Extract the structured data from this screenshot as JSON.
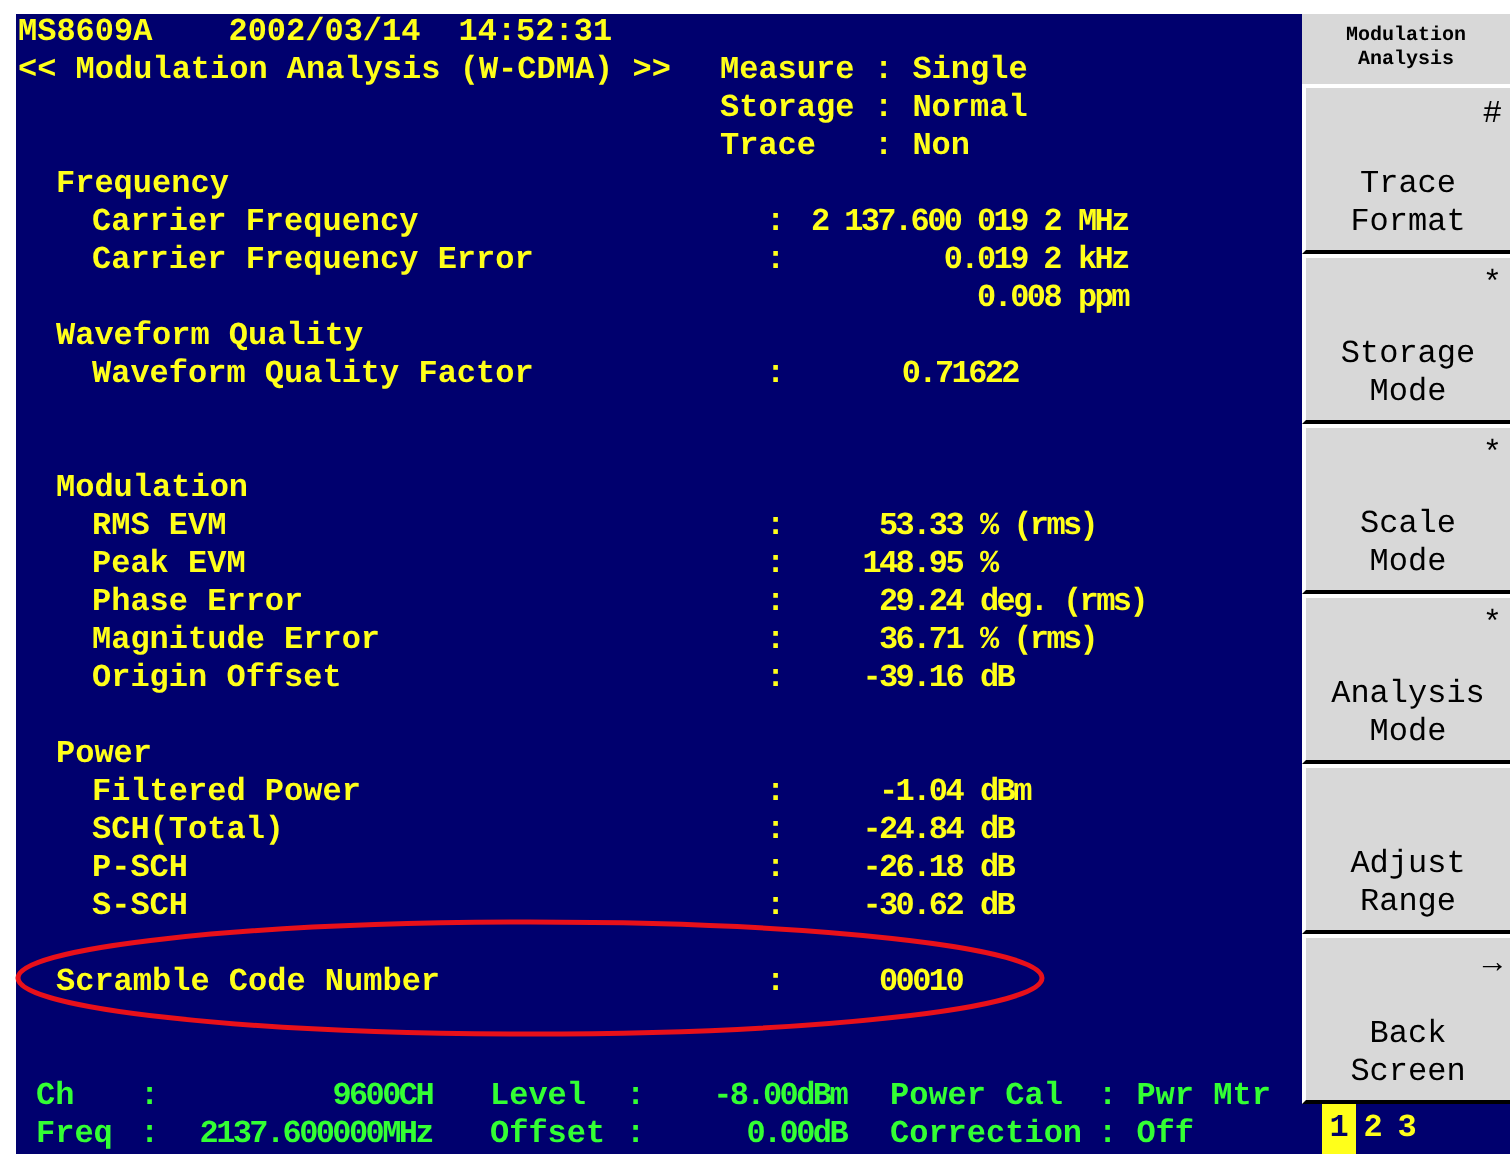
{
  "header": {
    "model": "MS8609A",
    "date": "2002/03/14",
    "time": "14:52:31",
    "title": "<< Modulation Analysis (W-CDMA) >>"
  },
  "settings": [
    {
      "label": "Measure",
      "value": ": Single"
    },
    {
      "label": "Storage",
      "value": ": Normal"
    },
    {
      "label": "Trace",
      "value": ": Non"
    }
  ],
  "sections": [
    {
      "title": "Frequency",
      "rows": [
        {
          "label": "Carrier Frequency",
          "colon": ":",
          "value": "2 137.600 019 2",
          "unit": "MHz"
        },
        {
          "label": "Carrier Frequency Error",
          "colon": ":",
          "value": "0.019 2",
          "unit": "kHz"
        },
        {
          "value": "0.008",
          "unit": "ppm"
        }
      ]
    },
    {
      "title": "Waveform Quality",
      "rows": [
        {
          "label": "Waveform Quality Factor",
          "colon": ":",
          "value": "0.71622"
        }
      ]
    },
    {
      "title": "Modulation",
      "rows": [
        {
          "label": "RMS EVM",
          "colon": ":",
          "value": "53.33",
          "unit": "% (rms)"
        },
        {
          "label": "Peak EVM",
          "colon": ":",
          "value": "148.95",
          "unit": "%"
        },
        {
          "label": "Phase Error",
          "colon": ":",
          "value": "29.24",
          "unit": "deg. (rms)"
        },
        {
          "label": "Magnitude Error",
          "colon": ":",
          "value": "36.71",
          "unit": "% (rms)"
        },
        {
          "label": "Origin Offset",
          "colon": ":",
          "value": "-39.16",
          "unit": "dB"
        }
      ]
    },
    {
      "title": "Power",
      "rows": [
        {
          "label": "Filtered Power",
          "colon": ":",
          "value": "-1.04",
          "unit": "dBm"
        },
        {
          "label": "SCH(Total)",
          "colon": ":",
          "value": "-24.84",
          "unit": "dB"
        },
        {
          "label": "P-SCH",
          "colon": ":",
          "value": "-26.18",
          "unit": "dB"
        },
        {
          "label": "S-SCH",
          "colon": ":",
          "value": "-30.62",
          "unit": "dB"
        }
      ]
    }
  ],
  "scramble": {
    "label": "Scramble Code Number",
    "colon": ":",
    "value": "00010"
  },
  "status_bar": [
    [
      {
        "label": "Ch",
        "colon": ":",
        "value": "9600CH"
      },
      {
        "label": "Level",
        "colon": ":",
        "value": "-8.00dBm"
      },
      {
        "label": "Power Cal",
        "value": ": Pwr Mtr"
      }
    ],
    [
      {
        "label": "Freq",
        "colon": ":",
        "value": "2137.600000MHz"
      },
      {
        "label": "Offset",
        "colon": ":",
        "value": "0.00dB"
      },
      {
        "label": "Correction",
        "value": ": Off"
      }
    ]
  ],
  "softkeys": {
    "title": "Modulation Analysis",
    "keys": [
      {
        "label": "Trace Format",
        "mark": "#"
      },
      {
        "label": "Storage Mode",
        "mark": "*"
      },
      {
        "label": "Scale Mode",
        "mark": "*"
      },
      {
        "label": "Analysis Mode",
        "mark": "*"
      },
      {
        "label": "Adjust Range"
      },
      {
        "label": "Back Screen",
        "mark": "→"
      }
    ],
    "pages": [
      {
        "label": "1",
        "selected": true
      },
      {
        "label": "2",
        "selected": false
      },
      {
        "label": "3",
        "selected": false
      }
    ]
  }
}
